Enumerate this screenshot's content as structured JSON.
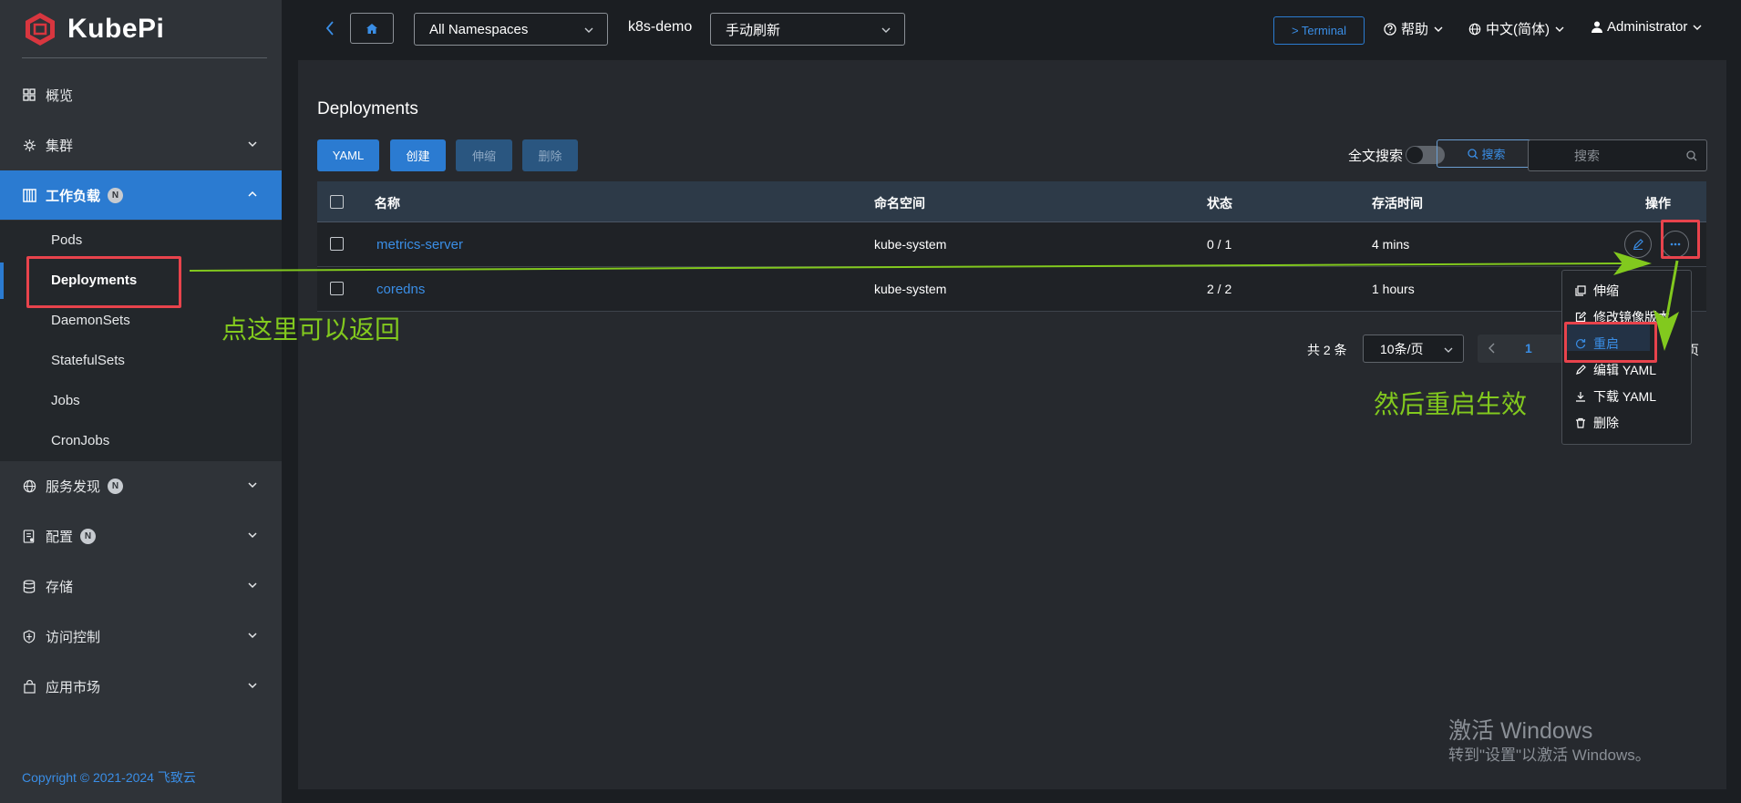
{
  "app": {
    "name": "KubePi"
  },
  "sidebar": {
    "items": [
      {
        "label": "概览",
        "icon": "dashboard-icon"
      },
      {
        "label": "集群",
        "icon": "cluster-icon"
      },
      {
        "label": "工作负载",
        "icon": "workload-icon",
        "badge": "N",
        "expanded": true
      },
      {
        "label": "服务发现",
        "icon": "globe-icon",
        "badge": "N"
      },
      {
        "label": "配置",
        "icon": "config-icon",
        "badge": "N"
      },
      {
        "label": "存储",
        "icon": "storage-icon"
      },
      {
        "label": "访问控制",
        "icon": "shield-icon"
      },
      {
        "label": "应用市场",
        "icon": "bag-icon"
      }
    ],
    "sub_items": [
      "Pods",
      "Deployments",
      "DaemonSets",
      "StatefulSets",
      "Jobs",
      "CronJobs"
    ],
    "selected_sub": "Deployments",
    "copyright": "Copyright © 2021-2024 飞致云"
  },
  "header": {
    "namespace": "All Namespaces",
    "cluster": "k8s-demo",
    "refresh": "手动刷新",
    "terminal": "> Terminal",
    "help": "帮助",
    "language": "中文(简体)",
    "user": "Administrator"
  },
  "page": {
    "title": "Deployments",
    "buttons": {
      "yaml": "YAML",
      "create": "创建",
      "scale": "伸缩",
      "delete": "删除"
    },
    "fulltext_label": "全文搜索",
    "search_button": "搜索",
    "search_placeholder": "搜索"
  },
  "table": {
    "headers": {
      "name": "名称",
      "namespace": "命名空间",
      "status": "状态",
      "age": "存活时间",
      "ops": "操作"
    },
    "rows": [
      {
        "name": "metrics-server",
        "namespace": "kube-system",
        "status": "0 / 1",
        "age": "4 mins"
      },
      {
        "name": "coredns",
        "namespace": "kube-system",
        "status": "2 / 2",
        "age": "1 hours"
      }
    ]
  },
  "pagination": {
    "total": "共 2 条",
    "page_size": "10条/页",
    "current": "1",
    "suffix": "页"
  },
  "dropdown": {
    "items": [
      {
        "label": "伸缩",
        "icon": "copy-icon"
      },
      {
        "label": "修改镜像版本",
        "icon": "edit-square-icon"
      },
      {
        "label": "重启",
        "icon": "refresh-icon"
      },
      {
        "label": "编辑 YAML",
        "icon": "pencil-icon"
      },
      {
        "label": "下载 YAML",
        "icon": "download-icon"
      },
      {
        "label": "删除",
        "icon": "trash-icon"
      }
    ]
  },
  "annotations": {
    "back_hint": "点这里可以返回",
    "restart_hint": "然后重启生效"
  },
  "watermark": {
    "line1": "激活 Windows",
    "line2": "转到\"设置\"以激活 Windows。"
  },
  "colors": {
    "accent": "#2b7bd1",
    "annotation": "#82c91e",
    "highlight_box": "#e8434c"
  }
}
